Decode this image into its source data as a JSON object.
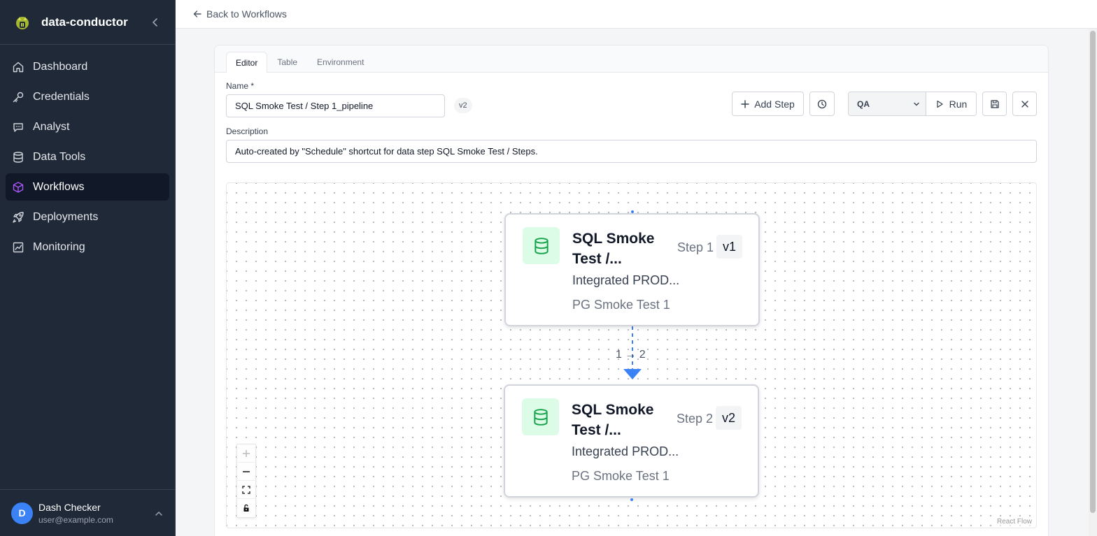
{
  "app": {
    "name": "data-conductor"
  },
  "sidebar": {
    "items": [
      {
        "label": "Dashboard",
        "icon": "home-icon",
        "active": false
      },
      {
        "label": "Credentials",
        "icon": "key-icon",
        "active": false
      },
      {
        "label": "Analyst",
        "icon": "chat-icon",
        "active": false
      },
      {
        "label": "Data Tools",
        "icon": "database-icon",
        "active": false
      },
      {
        "label": "Workflows",
        "icon": "cube-icon",
        "active": true
      },
      {
        "label": "Deployments",
        "icon": "rocket-icon",
        "active": false
      },
      {
        "label": "Monitoring",
        "icon": "chart-icon",
        "active": false
      }
    ]
  },
  "user": {
    "initial": "D",
    "name": "Dash Checker",
    "email": "user@example.com"
  },
  "topbar": {
    "back_label": "Back to Workflows"
  },
  "tabs": [
    {
      "label": "Editor",
      "active": true
    },
    {
      "label": "Table",
      "active": false
    },
    {
      "label": "Environment",
      "active": false
    }
  ],
  "form": {
    "name_label": "Name *",
    "name_value": "SQL Smoke Test / Step 1_pipeline",
    "version_badge": "v2",
    "description_label": "Description",
    "description_value": "Auto-created by \"Schedule\" shortcut for data step SQL Smoke Test / Steps."
  },
  "toolbar": {
    "add_step_label": "Add Step",
    "environment_value": "QA",
    "run_label": "Run"
  },
  "nodes": [
    {
      "title": "SQL Smoke Test /...",
      "step": "Step 1",
      "version": "v1",
      "subtitle": "Integrated PROD...",
      "credential": "PG Smoke Test 1"
    },
    {
      "title": "SQL Smoke Test /...",
      "step": "Step 2",
      "version": "v2",
      "subtitle": "Integrated PROD...",
      "credential": "PG Smoke Test 1"
    }
  ],
  "edge": {
    "label": "1 → 2"
  },
  "canvas": {
    "attribution": "React Flow"
  },
  "colors": {
    "accent": "#a855f7",
    "edge": "#3b82f6",
    "node_icon": "#16a34a",
    "sidebar_bg": "#1f2937"
  }
}
